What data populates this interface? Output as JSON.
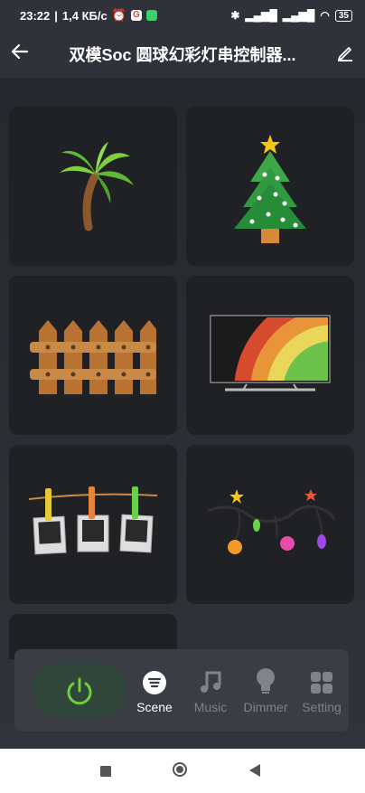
{
  "status": {
    "time": "23:22",
    "speed": "1,4 КБ/с",
    "battery": "35"
  },
  "header": {
    "title": "双模Soc 圆球幻彩灯串控制器..."
  },
  "scenes": [
    {
      "icon": "palm-tree-icon"
    },
    {
      "icon": "christmas-tree-icon"
    },
    {
      "icon": "fence-icon"
    },
    {
      "icon": "rainbow-tv-icon"
    },
    {
      "icon": "photos-clothesline-icon"
    },
    {
      "icon": "string-lights-icon"
    }
  ],
  "bottom": {
    "tabs": [
      {
        "label": "Scene"
      },
      {
        "label": "Music"
      },
      {
        "label": "Dimmer"
      },
      {
        "label": "Setting"
      }
    ],
    "active_tab": "Scene"
  },
  "colors": {
    "accent_green": "#6ecf3c",
    "panel": "#3a3d44",
    "card": "#1f2125"
  }
}
